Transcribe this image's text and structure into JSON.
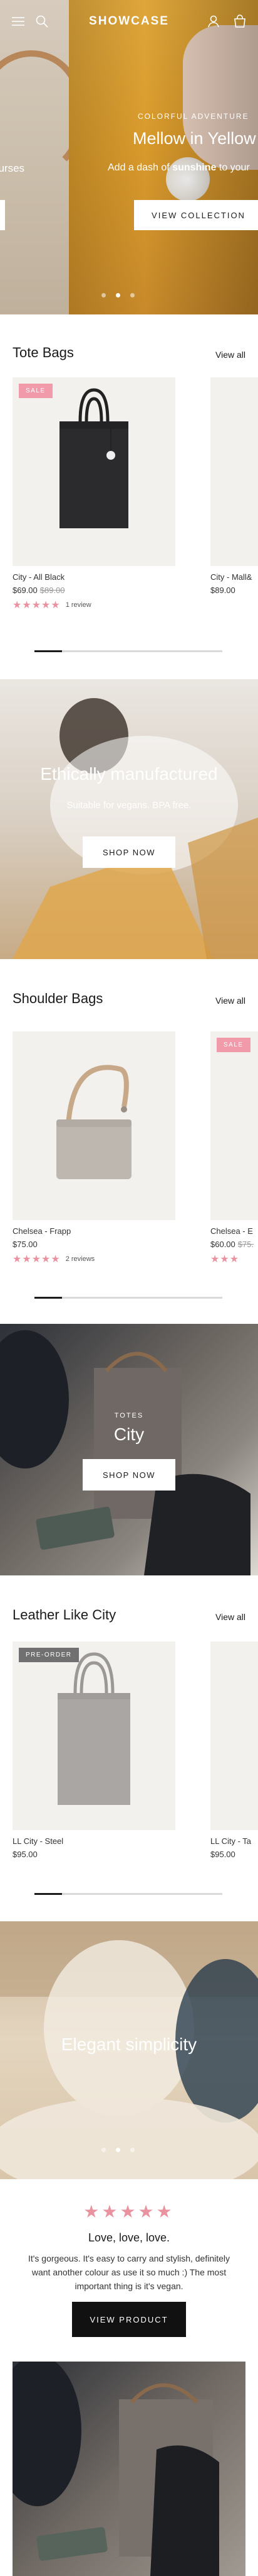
{
  "header": {
    "logo": "SHOWCASE",
    "icons": [
      "hamburger-menu-icon",
      "search-icon",
      "user-icon",
      "cart-icon"
    ],
    "icon_color": "#ffffff"
  },
  "hero": {
    "left_slide_text": "ourses",
    "kicker": "COLORFUL ADVENTURE",
    "title": "Mellow in Yellow",
    "desc_before": "Add a dash of ",
    "desc_bold": "sunshine",
    "desc_after": " to your",
    "button": "VIEW COLLECTION",
    "slide_count": 3,
    "active_slide": 1
  },
  "tote_bags": {
    "title": "Tote Bags",
    "view_all": "View all",
    "products": [
      {
        "badge": "SALE",
        "name": "City - All Black",
        "price": "$69.00",
        "compare_price": "$89.00",
        "stars": "★★★★★",
        "reviews": "1 review"
      },
      {
        "badge": "",
        "name": "City - Mall&",
        "price": "$89.00",
        "compare_price": "",
        "stars": "",
        "reviews": ""
      }
    ]
  },
  "ethical_banner": {
    "title": "Ethically manufactured",
    "subtitle": "Suitable for vegans. BPA free.",
    "button": "SHOP NOW"
  },
  "shoulder_bags": {
    "title": "Shoulder Bags",
    "view_all": "View all",
    "products": [
      {
        "badge": "",
        "name": "Chelsea - Frapp",
        "price": "$75.00",
        "compare_price": "",
        "stars": "★★★★★",
        "reviews": "2 reviews"
      },
      {
        "badge": "SALE",
        "name": "Chelsea - E",
        "price": "$60.00",
        "compare_price": "$75.",
        "stars": "★★★",
        "reviews": ""
      }
    ]
  },
  "totes_banner": {
    "kicker": "TOTES",
    "title": "City",
    "button": "SHOP NOW"
  },
  "leather_like": {
    "title": "Leather Like City",
    "view_all": "View all",
    "products": [
      {
        "badge": "PRE-ORDER",
        "name": "LL City - Steel",
        "price": "$95.00"
      },
      {
        "badge": "",
        "name": "LL City - Ta",
        "price": "$95.00"
      }
    ]
  },
  "elegant_banner": {
    "title": "Elegant simplicity",
    "slide_count": 3,
    "active_slide": 1
  },
  "review": {
    "stars": "★★★★★",
    "title": "Love, love, love.",
    "text": "It's gorgeous. It's easy to carry and stylish, definitely want another colour as use it so much :) The most important thing is it's vegan.",
    "button": "VIEW PRODUCT"
  },
  "colors": {
    "accent_pink": "#e8939f",
    "sale_badge": "#f19aa9",
    "preorder_badge": "#707070",
    "hero_yellow": "#d99a2b",
    "dark_button": "#111111"
  }
}
